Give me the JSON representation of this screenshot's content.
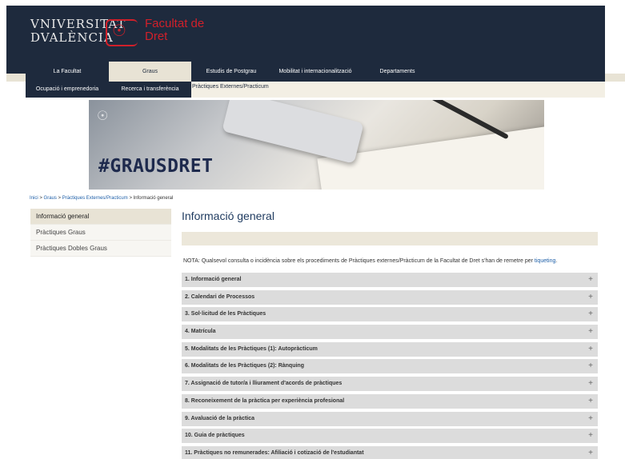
{
  "header": {
    "university_line1": "VNIVERSITAT",
    "university_line2": "DVALÈNCIA",
    "faculty_line1": "Facultat de",
    "faculty_line2": "Dret",
    "seal_glyph": "☉"
  },
  "nav": {
    "items": [
      {
        "label": "La Facultat"
      },
      {
        "label": "Graus"
      },
      {
        "label": "Estudis de Postgrau"
      },
      {
        "label": "Mobilitat i internacionalització"
      },
      {
        "label": "Departaments"
      }
    ],
    "active": "Graus"
  },
  "subnav": {
    "items": [
      {
        "label": "Ocupació i emprenedoria"
      },
      {
        "label": "Recerca i transferència"
      },
      {
        "label": "Pràctiques Externes/Practicum"
      }
    ]
  },
  "banner": {
    "hashtag": "#GRAUSDRET"
  },
  "breadcrumb": {
    "links": [
      "Inici",
      "Graus",
      "Pràctiques Externes/Practicum"
    ],
    "separator": ">",
    "current": "Informació general"
  },
  "sidebar": {
    "items": [
      {
        "label": "Informació general",
        "active": true
      },
      {
        "label": "Pràctiques Graus",
        "active": false
      },
      {
        "label": "Pràctiques Dobles Graus",
        "active": false
      }
    ]
  },
  "main": {
    "title": "Informació general",
    "note_text": "NOTA: Qualsevol consulta o incidència sobre els procediments de Pràctiques externes/Pràcticum de la Facultat de Dret s'han de remetre per ",
    "note_link": "tiqueting",
    "note_end": ".",
    "accordion": [
      "1. Informació general",
      "2. Calendari de Processos",
      "3. Sol·licitud de les Pràctiques",
      "4. Matrícula",
      "5. Modalitats de les Pràctiques (1): Autopràcticum",
      "6. Modalitats de les Pràctiques (2): Rànquing",
      "7. Assignació de tutor/a i lliurament d'acords de pràctiques",
      "8. Reconeixement de la pràctica per experiència profesional",
      "9. Avaluació de la pràctica",
      "10. Guia de pràctiques",
      "11. Pràctiques no remunerades: Afiliació i cotizació de l'estudiantat"
    ],
    "expand_glyph": "+"
  },
  "colors": {
    "navy": "#1e2a3d",
    "accent_red": "#d0202a",
    "beige": "#e8e3d5",
    "link_blue": "#1e5fa8"
  }
}
